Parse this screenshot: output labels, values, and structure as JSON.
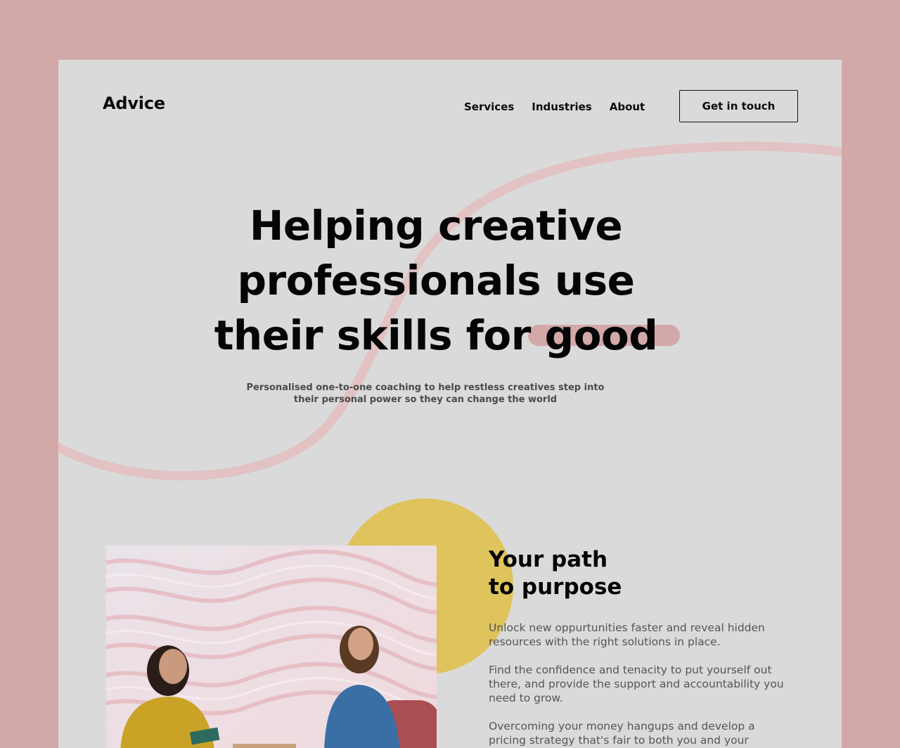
{
  "brand": {
    "logo_text": "Advice"
  },
  "nav": {
    "items": [
      {
        "label": "Services"
      },
      {
        "label": "Industries"
      },
      {
        "label": "About"
      }
    ],
    "cta_label": "Get in touch"
  },
  "hero": {
    "title_part1": "Helping creative professionals use their skills for",
    "title_highlight": "good",
    "subtitle": "Personalised one-to-one coaching to help restless creatives step into their personal power so they can change the world"
  },
  "section": {
    "title_line1": "Your path",
    "title_line2": "to purpose",
    "paragraphs": [
      "Unlock new oppurtunities faster and reveal hidden resources with the right solutions in place.",
      "Find the confidence and tenacity to put yourself out there, and provide the support and accountability you need to grow.",
      "Overcoming your money hangups and develop a pricing strategy that's fair to both you and your"
    ]
  },
  "colors": {
    "background": "#d3a8a8",
    "page": "#dadada",
    "accent_pink": "#d3a8a8",
    "accent_yellow": "#dfc35c",
    "text": "#050505"
  },
  "icons": {
    "decoration": "swoosh-curve"
  }
}
